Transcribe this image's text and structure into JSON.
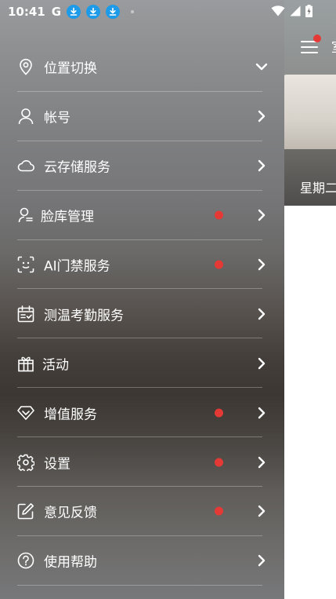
{
  "status_bar": {
    "time": "10:41",
    "g_label": "G",
    "icons": [
      "download-icon",
      "download-icon",
      "download-icon",
      "dot-icon",
      "wifi-icon",
      "signal-icon",
      "battery-charging-icon"
    ]
  },
  "background_app": {
    "title_partial": "室",
    "date_partial": "星期二"
  },
  "drawer": {
    "items": [
      {
        "label": "位置切换",
        "icon": "location-pin-icon",
        "badge": false,
        "arrow": "chevron-down-icon"
      },
      {
        "label": "帐号",
        "icon": "user-icon",
        "badge": false,
        "arrow": "chevron-right-icon"
      },
      {
        "label": "云存储服务",
        "icon": "cloud-icon",
        "badge": false,
        "arrow": "chevron-right-icon"
      },
      {
        "label": "脸库管理",
        "icon": "face-library-icon",
        "badge": true,
        "arrow": "chevron-right-icon"
      },
      {
        "label": "AI门禁服务",
        "icon": "face-scan-icon",
        "badge": true,
        "arrow": "chevron-right-icon"
      },
      {
        "label": "测温考勤服务",
        "icon": "calendar-check-icon",
        "badge": false,
        "arrow": "chevron-right-icon"
      },
      {
        "label": "活动",
        "icon": "gift-icon",
        "badge": false,
        "arrow": "chevron-right-icon"
      },
      {
        "label": "增值服务",
        "icon": "diamond-icon",
        "badge": true,
        "arrow": "chevron-right-icon"
      },
      {
        "label": "设置",
        "icon": "gear-icon",
        "badge": true,
        "arrow": "chevron-right-icon"
      },
      {
        "label": "意见反馈",
        "icon": "edit-icon",
        "badge": true,
        "arrow": "chevron-right-icon"
      },
      {
        "label": "使用帮助",
        "icon": "help-icon",
        "badge": false,
        "arrow": "chevron-right-icon"
      }
    ]
  },
  "colors": {
    "badge": "#e53935",
    "download_badge": "#1e9be8",
    "text": "#ffffff"
  }
}
